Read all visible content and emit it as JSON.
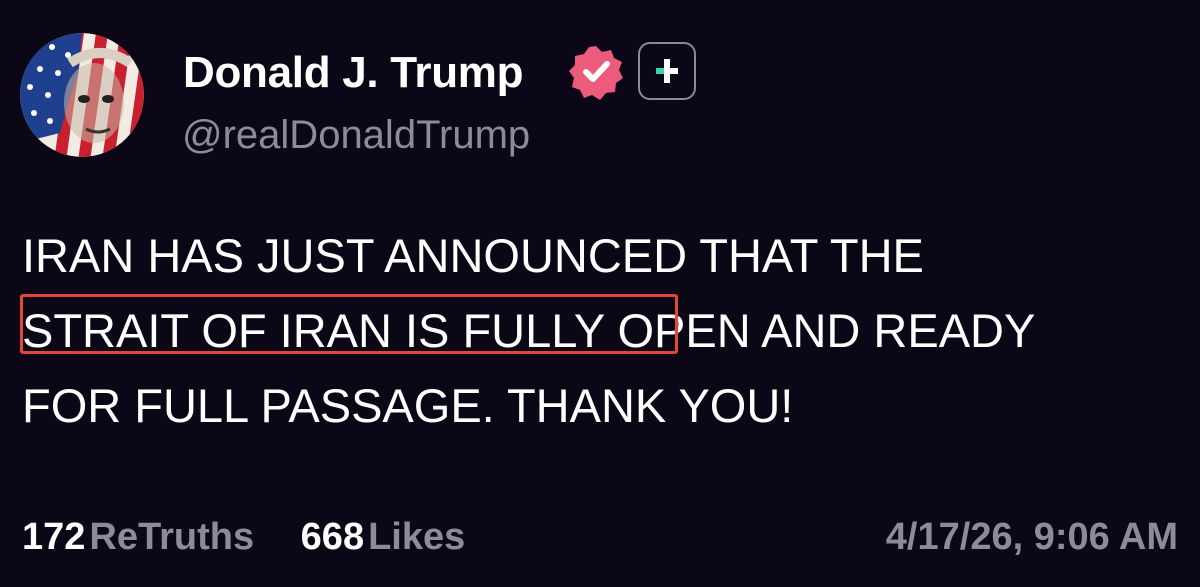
{
  "author": {
    "display_name": "Donald J. Trump",
    "handle": "@realDonaldTrump",
    "avatar_icon": "flag-portrait-avatar",
    "verified_icon": "verified-badge-icon",
    "verified_color": "#ec5b7b",
    "follow_icon": "plus-icon"
  },
  "post": {
    "lines": [
      "IRAN HAS JUST ANNOUNCED THAT THE",
      "STRAIT OF IRAN IS FULLY OPEN AND READY",
      "FOR FULL PASSAGE. THANK YOU!"
    ],
    "highlight_color": "#e4473a"
  },
  "stats": {
    "retruths_count": "172",
    "retruths_label": "ReTruths",
    "likes_count": "668",
    "likes_label": "Likes"
  },
  "timestamp": "4/17/26, 9:06 AM",
  "theme": {
    "background": "#0b0717",
    "secondary_text": "#8e8b99",
    "accent": "#3ad0b0"
  }
}
